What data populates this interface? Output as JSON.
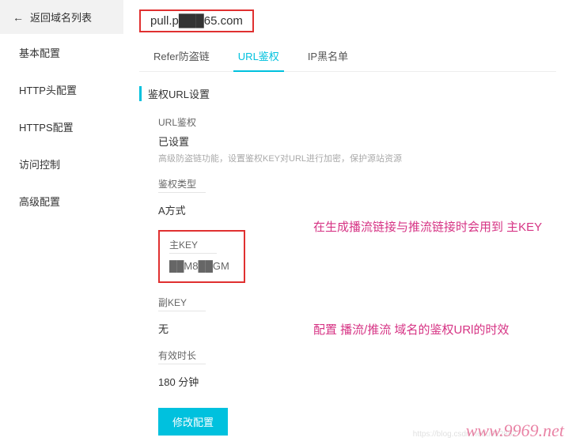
{
  "back_label": "返回域名列表",
  "sidebar": {
    "items": [
      {
        "label": "基本配置"
      },
      {
        "label": "HTTP头配置"
      },
      {
        "label": "HTTPS配置"
      },
      {
        "label": "访问控制"
      },
      {
        "label": "高级配置"
      }
    ]
  },
  "domain": "pull.p███65.com",
  "tabs": {
    "refer": "Refer防盗链",
    "url_auth": "URL鉴权",
    "ip_blacklist": "IP黑名单"
  },
  "section_title": "鉴权URL设置",
  "fields": {
    "url_auth": {
      "label": "URL鉴权",
      "value": "已设置",
      "desc": "高级防盗链功能，设置鉴权KEY对URL进行加密，保护源站资源"
    },
    "auth_type": {
      "label": "鉴权类型",
      "value": "A方式"
    },
    "main_key": {
      "label": "主KEY",
      "value": "██M8██GM"
    },
    "sub_key": {
      "label": "副KEY",
      "value": "无"
    },
    "ttl": {
      "label": "有效时长",
      "value": "180 分钟"
    }
  },
  "annotations": {
    "key": "在生成播流链接与推流链接时会用到  主KEY",
    "ttl": "配置  播流/推流  域名的鉴权URl的时效"
  },
  "button": "修改配置",
  "watermark": "www.9969.net",
  "watermark2": "https://blog.csdn.net/u012852"
}
